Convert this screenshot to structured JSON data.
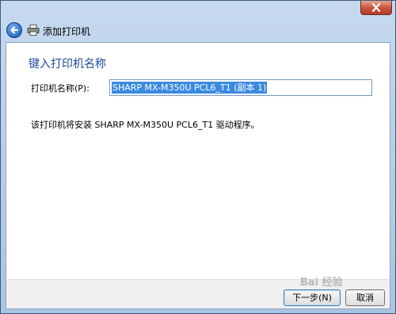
{
  "window": {
    "title": "添加打印机"
  },
  "page": {
    "heading": "键入打印机名称",
    "printer_name_label": "打印机名称(P):",
    "printer_name_value": "SHARP MX-M350U PCL6_T1 (副本 1)",
    "info_text": "该打印机将安装 SHARP MX-M350U PCL6_T1 驱动程序。"
  },
  "buttons": {
    "next": "下一步(N)",
    "cancel": "取消"
  },
  "watermark": "Bai 经验",
  "icons": {
    "back": "back-arrow-icon",
    "printer": "printer-icon",
    "close": "close-icon"
  },
  "colors": {
    "heading": "#1d4aa0",
    "selection": "#3a8ae0",
    "frame": "#c6d9ef",
    "close_button": "#c7513a"
  }
}
